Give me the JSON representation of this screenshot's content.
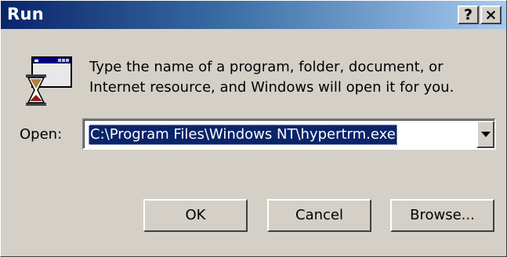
{
  "window": {
    "title": "Run",
    "help_label": "?",
    "close_label": "×"
  },
  "description": {
    "line1": "Type the name of a program, folder, document, or",
    "line2": "Internet resource, and Windows will open it for you."
  },
  "open": {
    "label": "Open:",
    "value": "C:\\Program Files\\Windows NT\\hypertrm.exe"
  },
  "buttons": {
    "ok": "OK",
    "cancel": "Cancel",
    "browse": "Browse..."
  },
  "colors": {
    "titlebar_start": "#0a246a",
    "titlebar_end": "#a6caf0",
    "selection": "#0a246a",
    "face": "#d4d0c8"
  }
}
